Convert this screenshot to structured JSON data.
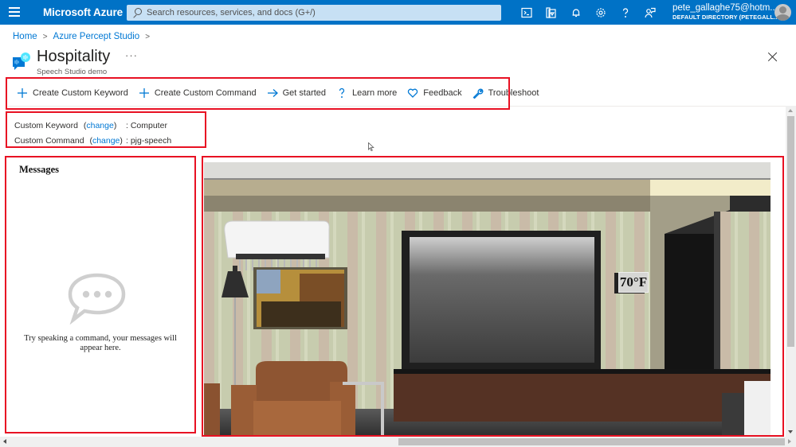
{
  "topbar": {
    "brand": "Microsoft Azure",
    "search_placeholder": "Search resources, services, and docs (G+/)",
    "icons": [
      "cloud-shell-icon",
      "directory-filter-icon",
      "notifications-icon",
      "settings-icon",
      "help-icon",
      "feedback-icon"
    ],
    "account_email": "pete_gallaghe75@hotm...",
    "account_directory": "DEFAULT DIRECTORY (PETEGALL..."
  },
  "breadcrumb": [
    {
      "label": "Home"
    },
    {
      "label": "Azure Percept Studio"
    }
  ],
  "page": {
    "title": "Hospitality",
    "more": "···",
    "subtitle": "Speech Studio demo"
  },
  "toolbar": {
    "items": [
      {
        "label": "Create Custom Keyword",
        "icon": "plus-icon"
      },
      {
        "label": "Create Custom Command",
        "icon": "plus-icon"
      },
      {
        "label": "Get started",
        "icon": "arrow-right-icon"
      },
      {
        "label": "Learn more",
        "icon": "question-icon"
      },
      {
        "label": "Feedback",
        "icon": "heart-icon"
      },
      {
        "label": "Troubleshoot",
        "icon": "wrench-icon"
      }
    ]
  },
  "settings": {
    "keyword_label": "Custom Keyword",
    "keyword_value": ": Computer",
    "command_label": "Custom Command",
    "command_value": ": pjg-speech",
    "change_label": "change",
    "open_paren": "(",
    "close_paren": ")"
  },
  "messages": {
    "title": "Messages",
    "empty_text": "Try speaking a command, your messages will appear here."
  },
  "scene": {
    "thermostat_reading": "70°F"
  },
  "colors": {
    "azure_blue": "#0072c6",
    "link": "#0078d4",
    "annotation_red": "#e81123"
  }
}
